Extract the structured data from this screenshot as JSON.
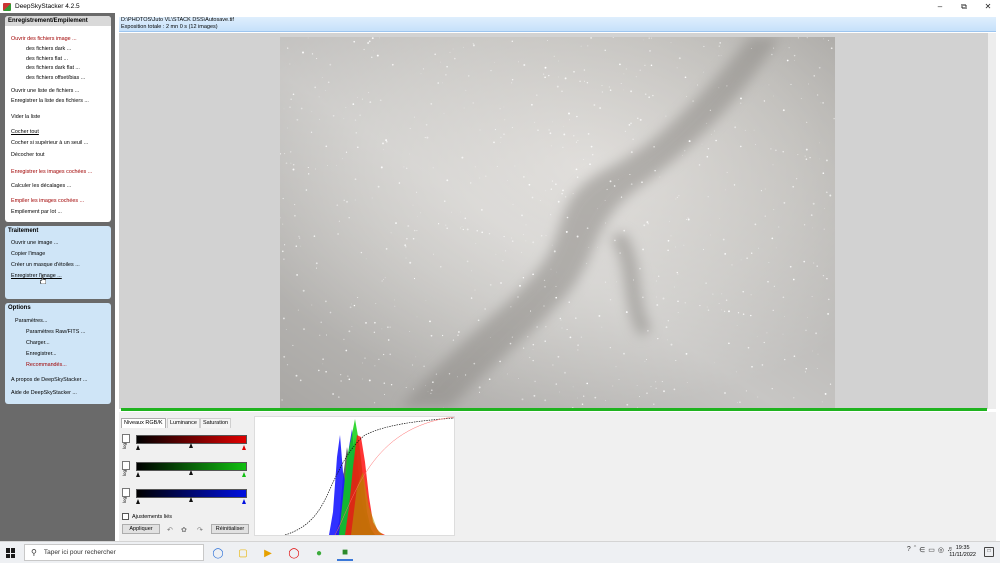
{
  "window": {
    "title": "DeepSkyStacker 4.2.5",
    "controls": [
      "minimize",
      "restore",
      "close"
    ]
  },
  "left_panel": {
    "registering": {
      "header": "Enregistrement/Empilement",
      "open_images": "Ouvrir des fichiers image ...",
      "dark_files": "des fichiers dark ...",
      "flat_files": "des fichiers flat ...",
      "dark_flat_files": "des fichiers dark flat ...",
      "offset_files": "des fichiers offset/bias ...",
      "open_list": "Ouvrir une liste de fichiers ...",
      "save_list": "Enregistrer la liste des fichiers ...",
      "clear_list": "Vider la liste",
      "check_all": "Cocher tout",
      "check_above": "Cocher si supérieur à un seuil ...",
      "uncheck_all": "Décocher tout",
      "register_checked": "Enregistrer les images cochées ...",
      "compute_offsets": "Calculer les décalages ...",
      "stack_checked": "Empiler les images cochées ...",
      "batch_stacking": "Empilement par lot ..."
    },
    "processing": {
      "header": "Traitement",
      "open_image": "Ouvrir une image ...",
      "copy_image": "Copier l'image",
      "create_star_mask": "Créer un masque d'étoiles ...",
      "save_image": "Enregistrer l'image ..."
    },
    "options": {
      "header": "Options",
      "settings": "Paramètres...",
      "raw_fits": "Paramètres Raw/FITS ...",
      "load": "Charger...",
      "save": "Enregistrer...",
      "recommended": "Recommandés...",
      "about": "A propos de DeepSkyStacker ...",
      "help": "Aide de DeepSkyStacker ..."
    }
  },
  "info": {
    "path": "D:\\PHOTOS\\Juto VL\\STACK DSS\\Autosave.tif",
    "exposure": "Exposition totale : 2 mn 0 s (12 images)"
  },
  "levels": {
    "tabs": [
      "Niveaux RGB/K",
      "Luminance",
      "Saturation"
    ],
    "log_label": "log",
    "linked_label": "Ajustements liés",
    "apply": "Appliquer",
    "reset": "Réinitialiser",
    "channels": [
      {
        "name": "red",
        "color": "#e00000"
      },
      {
        "name": "green",
        "color": "#10c010"
      },
      {
        "name": "blue",
        "color": "#0010e0"
      }
    ]
  },
  "taskbar": {
    "search_placeholder": "Taper ici pour rechercher",
    "apps": [
      "cortana-icon",
      "file-explorer-icon",
      "media-player-icon",
      "opera-icon",
      "utorrent-icon",
      "deepskystacker-icon"
    ],
    "time": "19:35",
    "date": "11/11/2022"
  }
}
